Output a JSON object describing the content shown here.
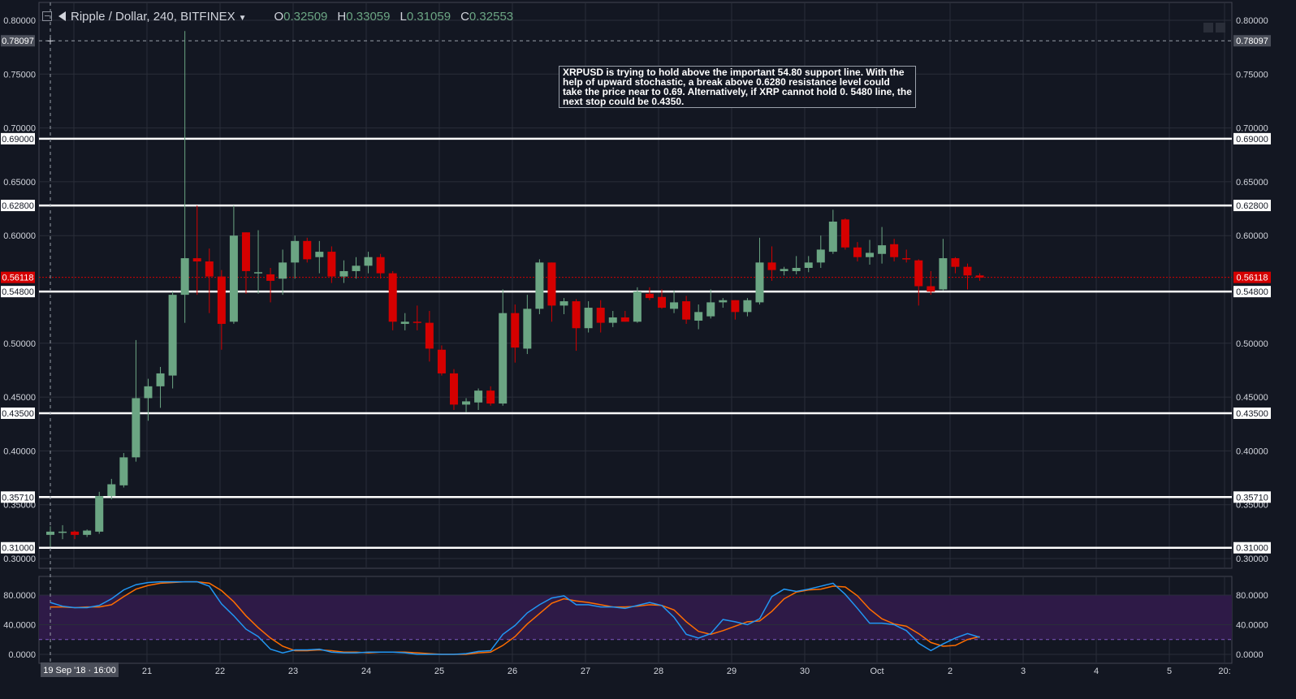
{
  "header": {
    "symbol": "Ripple / Dollar, 240, BITFINEX",
    "open_label": "O",
    "open": "0.32509",
    "high_label": "H",
    "high": "0.33059",
    "low_label": "L",
    "low": "0.31059",
    "close_label": "C",
    "close": "0.32553"
  },
  "annotation": "XRPUSD is trying to hold above the important 54.80 support line. With the help of upward stochastic, a break above 0.6280 resistance level could take the price near to 0.69. Alternatively, if XRP cannot hold 0. 5480 line, the next stop could be 0.4350.",
  "colors": {
    "background": "#131722",
    "up": "#6ba583",
    "down": "#d50000",
    "k_line": "#2196f3",
    "d_line": "#ff6d00",
    "band": "#2e1a47"
  },
  "chart_data": {
    "type": "candlestick",
    "price_ticks": [
      "0.80000",
      "0.75000",
      "0.70000",
      "0.65000",
      "0.60000",
      "0.50000",
      "0.45000",
      "0.40000",
      "0.35000",
      "0.30000"
    ],
    "price_ylim": [
      0.3,
      0.8
    ],
    "horizontal_levels": [
      {
        "label": "0.69000",
        "value": 0.69
      },
      {
        "label": "0.62800",
        "value": 0.628
      },
      {
        "label": "0.54800",
        "value": 0.548
      },
      {
        "label": "0.43500",
        "value": 0.435
      },
      {
        "label": "0.35710",
        "value": 0.3571
      },
      {
        "label": "0.31000",
        "value": 0.31
      }
    ],
    "crosshair": {
      "label": "0.78097",
      "value": 0.78097
    },
    "last_price": {
      "label": "0.56118",
      "value": 0.56118
    },
    "x_labels": [
      "21",
      "22",
      "23",
      "24",
      "25",
      "26",
      "27",
      "28",
      "29",
      "30",
      "Oct",
      "2",
      "3",
      "4",
      "5",
      "20:"
    ],
    "x_first_label": "19 Sep '18 · 16:00",
    "candles": [
      [
        0.322,
        0.33,
        0.311,
        0.325
      ],
      [
        0.324,
        0.331,
        0.318,
        0.325
      ],
      [
        0.325,
        0.326,
        0.318,
        0.322
      ],
      [
        0.322,
        0.327,
        0.32,
        0.326
      ],
      [
        0.325,
        0.362,
        0.323,
        0.358
      ],
      [
        0.358,
        0.374,
        0.355,
        0.369
      ],
      [
        0.368,
        0.398,
        0.366,
        0.394
      ],
      [
        0.394,
        0.503,
        0.39,
        0.449
      ],
      [
        0.449,
        0.467,
        0.428,
        0.46
      ],
      [
        0.46,
        0.478,
        0.44,
        0.472
      ],
      [
        0.47,
        0.548,
        0.458,
        0.545
      ],
      [
        0.545,
        0.79,
        0.519,
        0.579
      ],
      [
        0.579,
        0.628,
        0.545,
        0.576
      ],
      [
        0.576,
        0.588,
        0.528,
        0.562
      ],
      [
        0.562,
        0.568,
        0.494,
        0.518
      ],
      [
        0.52,
        0.628,
        0.518,
        0.6
      ],
      [
        0.603,
        0.603,
        0.546,
        0.567
      ],
      [
        0.565,
        0.605,
        0.546,
        0.566
      ],
      [
        0.564,
        0.57,
        0.538,
        0.558
      ],
      [
        0.56,
        0.587,
        0.545,
        0.575
      ],
      [
        0.575,
        0.6,
        0.56,
        0.595
      ],
      [
        0.595,
        0.598,
        0.575,
        0.578
      ],
      [
        0.58,
        0.595,
        0.565,
        0.585
      ],
      [
        0.585,
        0.59,
        0.556,
        0.562
      ],
      [
        0.562,
        0.577,
        0.556,
        0.567
      ],
      [
        0.567,
        0.58,
        0.56,
        0.572
      ],
      [
        0.572,
        0.585,
        0.565,
        0.58
      ],
      [
        0.58,
        0.583,
        0.56,
        0.565
      ],
      [
        0.565,
        0.567,
        0.512,
        0.52
      ],
      [
        0.518,
        0.528,
        0.512,
        0.52
      ],
      [
        0.52,
        0.535,
        0.512,
        0.519
      ],
      [
        0.519,
        0.53,
        0.483,
        0.495
      ],
      [
        0.494,
        0.498,
        0.47,
        0.472
      ],
      [
        0.472,
        0.476,
        0.438,
        0.443
      ],
      [
        0.443,
        0.449,
        0.436,
        0.446
      ],
      [
        0.445,
        0.458,
        0.438,
        0.456
      ],
      [
        0.456,
        0.46,
        0.442,
        0.444
      ],
      [
        0.444,
        0.55,
        0.442,
        0.528
      ],
      [
        0.528,
        0.536,
        0.482,
        0.496
      ],
      [
        0.495,
        0.545,
        0.49,
        0.532
      ],
      [
        0.532,
        0.578,
        0.527,
        0.575
      ],
      [
        0.575,
        0.575,
        0.52,
        0.535
      ],
      [
        0.535,
        0.542,
        0.527,
        0.539
      ],
      [
        0.539,
        0.541,
        0.493,
        0.514
      ],
      [
        0.514,
        0.539,
        0.51,
        0.533
      ],
      [
        0.533,
        0.54,
        0.51,
        0.519
      ],
      [
        0.519,
        0.53,
        0.515,
        0.524
      ],
      [
        0.524,
        0.53,
        0.52,
        0.52
      ],
      [
        0.52,
        0.552,
        0.519,
        0.548
      ],
      [
        0.546,
        0.552,
        0.54,
        0.542
      ],
      [
        0.543,
        0.55,
        0.532,
        0.533
      ],
      [
        0.532,
        0.549,
        0.528,
        0.538
      ],
      [
        0.539,
        0.544,
        0.518,
        0.522
      ],
      [
        0.521,
        0.536,
        0.513,
        0.529
      ],
      [
        0.525,
        0.55,
        0.523,
        0.538
      ],
      [
        0.538,
        0.542,
        0.533,
        0.54
      ],
      [
        0.54,
        0.54,
        0.522,
        0.529
      ],
      [
        0.529,
        0.542,
        0.525,
        0.54
      ],
      [
        0.538,
        0.598,
        0.536,
        0.575
      ],
      [
        0.575,
        0.59,
        0.558,
        0.568
      ],
      [
        0.567,
        0.571,
        0.563,
        0.569
      ],
      [
        0.567,
        0.581,
        0.564,
        0.57
      ],
      [
        0.57,
        0.581,
        0.566,
        0.575
      ],
      [
        0.575,
        0.6,
        0.57,
        0.587
      ],
      [
        0.585,
        0.624,
        0.583,
        0.613
      ],
      [
        0.615,
        0.616,
        0.587,
        0.589
      ],
      [
        0.589,
        0.594,
        0.576,
        0.58
      ],
      [
        0.58,
        0.596,
        0.573,
        0.584
      ],
      [
        0.583,
        0.608,
        0.574,
        0.591
      ],
      [
        0.592,
        0.597,
        0.576,
        0.58
      ],
      [
        0.579,
        0.587,
        0.575,
        0.578
      ],
      [
        0.577,
        0.578,
        0.535,
        0.553
      ],
      [
        0.553,
        0.567,
        0.545,
        0.548
      ],
      [
        0.55,
        0.597,
        0.549,
        0.579
      ],
      [
        0.579,
        0.58,
        0.565,
        0.571
      ],
      [
        0.571,
        0.574,
        0.55,
        0.563
      ],
      [
        0.563,
        0.565,
        0.558,
        0.561
      ]
    ],
    "stoch_ticks": [
      "80.0000",
      "40.0000",
      "0.0000"
    ],
    "stoch_ylim": [
      0,
      100
    ],
    "stoch_band": [
      20,
      80
    ],
    "stoch_k": [
      70,
      65,
      63,
      63,
      66,
      75,
      87,
      94,
      97,
      98,
      98,
      98,
      98,
      92,
      68,
      52,
      34,
      24,
      7,
      2,
      6,
      6,
      7,
      3,
      2,
      2,
      3,
      3,
      3,
      2,
      0,
      0,
      0,
      0,
      1,
      4,
      5,
      27,
      39,
      56,
      67,
      76,
      79,
      67,
      67,
      64,
      64,
      62,
      66,
      70,
      66,
      50,
      27,
      22,
      28,
      47,
      44,
      40,
      48,
      78,
      88,
      85,
      88,
      92,
      96,
      81,
      62,
      42,
      42,
      40,
      32,
      15,
      5,
      14,
      22,
      28,
      23
    ],
    "stoch_d": [
      64,
      64,
      63,
      64,
      64,
      67,
      78,
      88,
      93,
      96,
      97,
      98,
      98,
      96,
      86,
      71,
      52,
      36,
      22,
      11,
      5,
      5,
      6,
      5,
      3,
      3,
      2,
      3,
      3,
      3,
      2,
      1,
      0,
      0,
      0,
      2,
      3,
      12,
      24,
      41,
      55,
      69,
      75,
      72,
      70,
      67,
      64,
      64,
      65,
      67,
      66,
      60,
      44,
      31,
      27,
      32,
      38,
      44,
      45,
      58,
      75,
      84,
      87,
      88,
      92,
      91,
      79,
      61,
      48,
      41,
      38,
      28,
      16,
      11,
      12,
      20,
      24
    ]
  }
}
